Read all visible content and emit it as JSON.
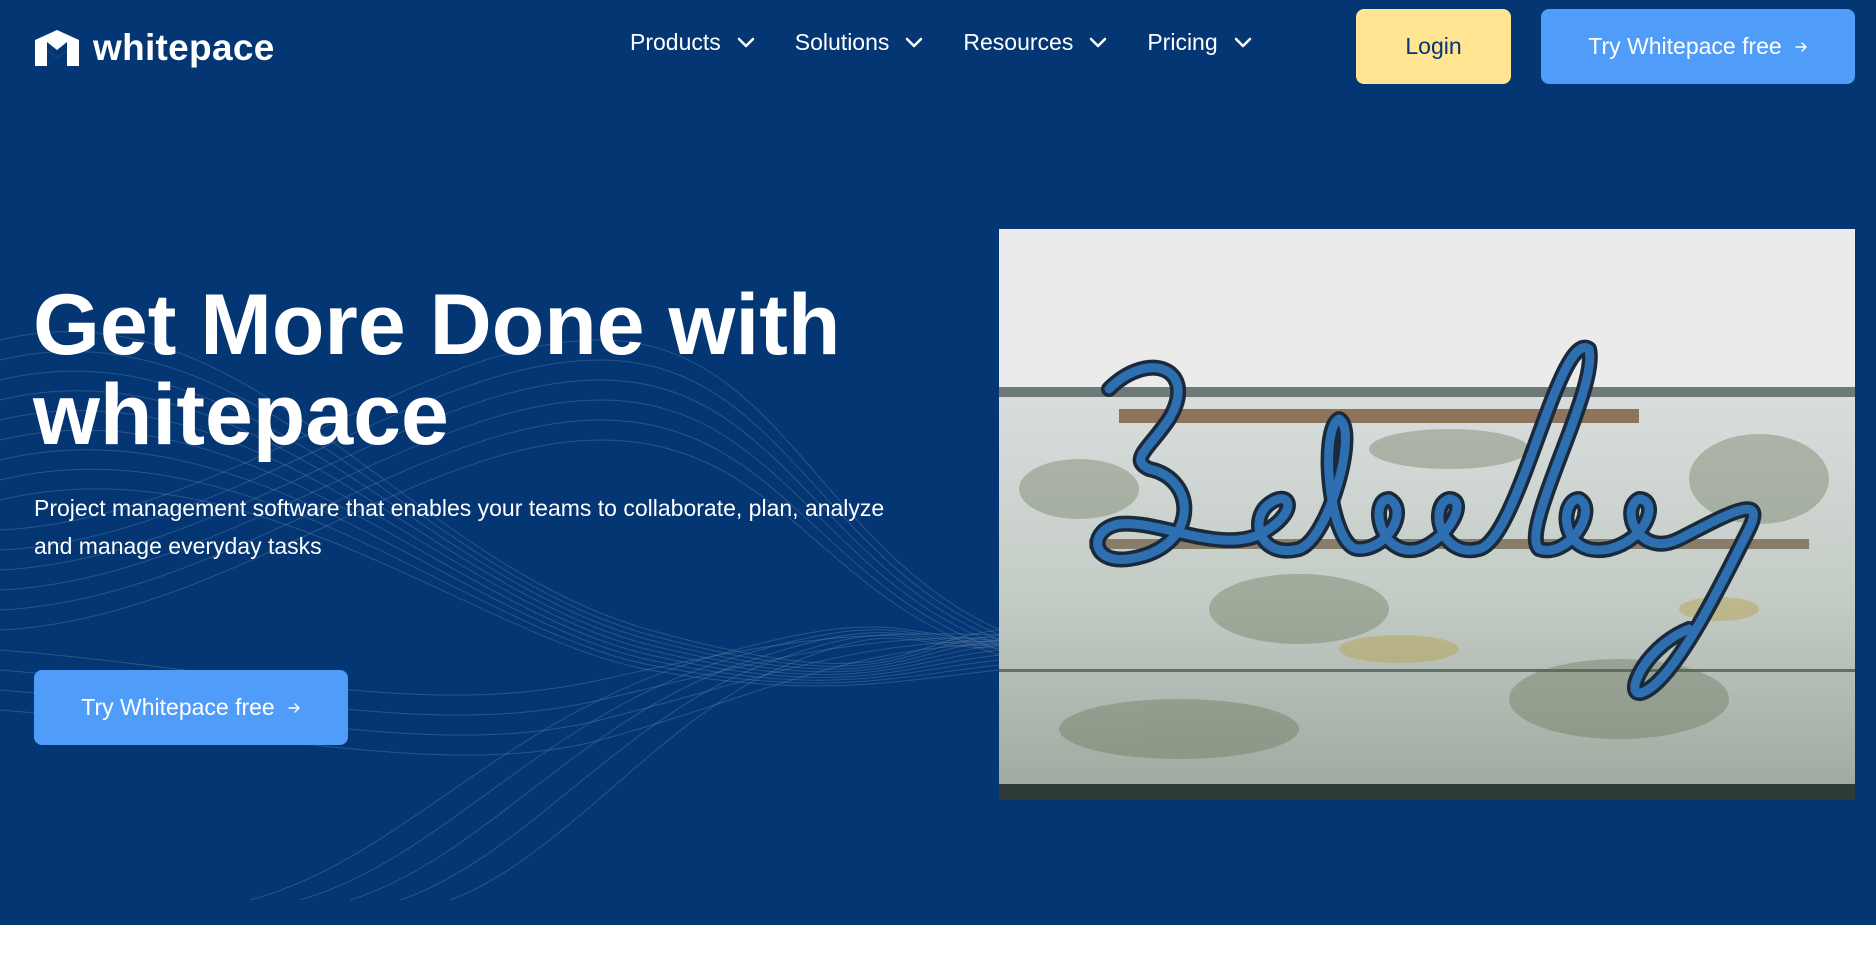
{
  "brand": {
    "name": "whitepace",
    "logo_icon": "whitepace-logo-icon",
    "colors": {
      "hero_bg": "#043673",
      "primary": "#4f9cf9",
      "login_bg": "#ffe492",
      "white": "#ffffff"
    }
  },
  "nav": {
    "items": [
      {
        "label": "Products",
        "icon": "chevron-down-icon"
      },
      {
        "label": "Solutions",
        "icon": "chevron-down-icon"
      },
      {
        "label": "Resources",
        "icon": "chevron-down-icon"
      },
      {
        "label": "Pricing",
        "icon": "chevron-down-icon"
      }
    ],
    "login_label": "Login",
    "cta_label": "Try Whitepace free",
    "cta_icon": "arrow-right-icon"
  },
  "hero": {
    "headline_line1": "Get More Done with",
    "headline_line2": "whitepace",
    "subtitle_line1": "Project management software that enables your teams to collaborate, plan, analyze",
    "subtitle_line2": "and manage everyday tasks",
    "cta_label": "Try Whitepace free",
    "cta_icon": "arrow-right-icon",
    "image_sign_text": "Bubbg"
  }
}
